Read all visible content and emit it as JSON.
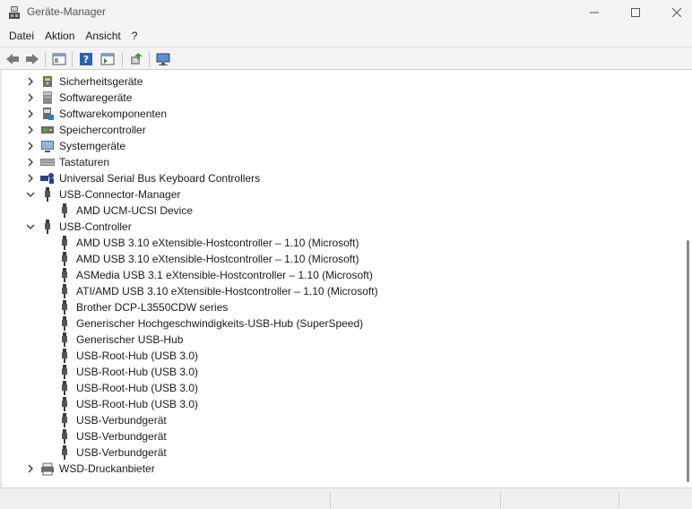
{
  "window": {
    "title": "Geräte-Manager"
  },
  "menu": [
    "Datei",
    "Aktion",
    "Ansicht",
    "?"
  ],
  "toolbar": {
    "buttons": [
      "back-icon",
      "forward-icon",
      "properties-pane-icon",
      "help-icon",
      "show-hide-tree-icon",
      "update-driver-icon",
      "scan-hardware-icon"
    ]
  },
  "tree": {
    "items": [
      {
        "label": "Sicherheitsgeräte",
        "level": 0,
        "expander": "collapsed",
        "icon": "security-device-icon"
      },
      {
        "label": "Softwaregeräte",
        "level": 0,
        "expander": "collapsed",
        "icon": "software-device-icon"
      },
      {
        "label": "Softwarekomponenten",
        "level": 0,
        "expander": "collapsed",
        "icon": "software-component-icon"
      },
      {
        "label": "Speichercontroller",
        "level": 0,
        "expander": "collapsed",
        "icon": "storage-controller-icon"
      },
      {
        "label": "Systemgeräte",
        "level": 0,
        "expander": "collapsed",
        "icon": "system-device-icon"
      },
      {
        "label": "Tastaturen",
        "level": 0,
        "expander": "collapsed",
        "icon": "keyboard-icon"
      },
      {
        "label": "Universal Serial Bus Keyboard Controllers",
        "level": 0,
        "expander": "collapsed",
        "icon": "usb-keyboard-controller-icon"
      },
      {
        "label": "USB-Connector-Manager",
        "level": 0,
        "expander": "expanded",
        "icon": "usb-icon"
      },
      {
        "label": "AMD UCM-UCSI Device",
        "level": 1,
        "expander": "none",
        "icon": "usb-icon"
      },
      {
        "label": "USB-Controller",
        "level": 0,
        "expander": "expanded",
        "icon": "usb-icon"
      },
      {
        "label": "AMD USB 3.10 eXtensible-Hostcontroller – 1.10 (Microsoft)",
        "level": 1,
        "expander": "none",
        "icon": "usb-icon"
      },
      {
        "label": "AMD USB 3.10 eXtensible-Hostcontroller – 1.10 (Microsoft)",
        "level": 1,
        "expander": "none",
        "icon": "usb-icon"
      },
      {
        "label": "ASMedia USB 3.1 eXtensible-Hostcontroller – 1.10 (Microsoft)",
        "level": 1,
        "expander": "none",
        "icon": "usb-icon"
      },
      {
        "label": "ATI/AMD USB 3.10 eXtensible-Hostcontroller – 1.10 (Microsoft)",
        "level": 1,
        "expander": "none",
        "icon": "usb-icon"
      },
      {
        "label": "Brother DCP-L3550CDW series",
        "level": 1,
        "expander": "none",
        "icon": "usb-icon"
      },
      {
        "label": "Generischer Hochgeschwindigkeits-USB-Hub (SuperSpeed)",
        "level": 1,
        "expander": "none",
        "icon": "usb-icon"
      },
      {
        "label": "Generischer USB-Hub",
        "level": 1,
        "expander": "none",
        "icon": "usb-icon"
      },
      {
        "label": "USB-Root-Hub (USB 3.0)",
        "level": 1,
        "expander": "none",
        "icon": "usb-icon"
      },
      {
        "label": "USB-Root-Hub (USB 3.0)",
        "level": 1,
        "expander": "none",
        "icon": "usb-icon"
      },
      {
        "label": "USB-Root-Hub (USB 3.0)",
        "level": 1,
        "expander": "none",
        "icon": "usb-icon"
      },
      {
        "label": "USB-Root-Hub (USB 3.0)",
        "level": 1,
        "expander": "none",
        "icon": "usb-icon"
      },
      {
        "label": "USB-Verbundgerät",
        "level": 1,
        "expander": "none",
        "icon": "usb-icon"
      },
      {
        "label": "USB-Verbundgerät",
        "level": 1,
        "expander": "none",
        "icon": "usb-icon"
      },
      {
        "label": "USB-Verbundgerät",
        "level": 1,
        "expander": "none",
        "icon": "usb-icon"
      },
      {
        "label": "WSD-Druckanbieter",
        "level": 0,
        "expander": "collapsed",
        "icon": "printer-icon"
      }
    ]
  },
  "colors": {
    "accent": "#0067c0",
    "background": "#ffffff",
    "chrome": "#f3f3f3"
  }
}
